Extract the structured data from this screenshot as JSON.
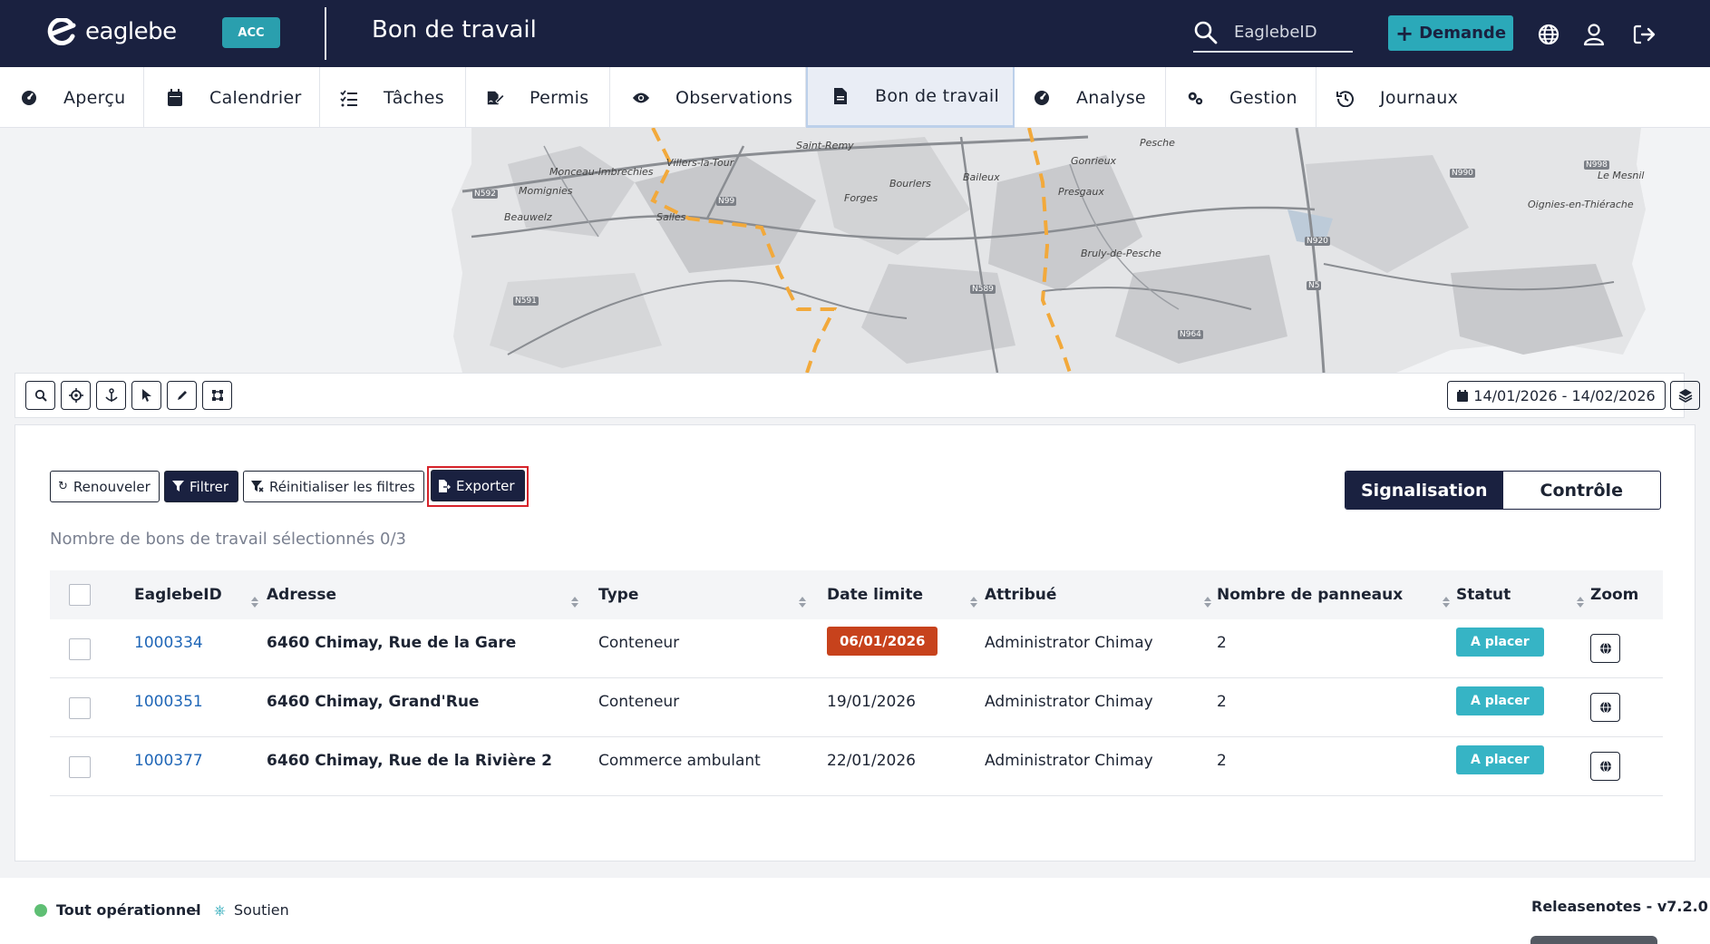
{
  "header": {
    "logo_text": "eaglebe",
    "env_badge": "ACC",
    "page_title": "Bon de travail",
    "search_placeholder": "EaglebeID",
    "demande_label": "Demande"
  },
  "nav": {
    "items": [
      {
        "label": "Aperçu",
        "icon": "gauge-icon"
      },
      {
        "label": "Calendrier",
        "icon": "calendar-icon"
      },
      {
        "label": "Tâches",
        "icon": "checklist-icon"
      },
      {
        "label": "Permis",
        "icon": "signature-icon"
      },
      {
        "label": "Observations",
        "icon": "eye-icon"
      },
      {
        "label": "Bon de travail",
        "icon": "file-icon",
        "active": true
      },
      {
        "label": "Analyse",
        "icon": "gauge-icon"
      },
      {
        "label": "Gestion",
        "icon": "gears-icon"
      },
      {
        "label": "Journaux",
        "icon": "history-icon"
      }
    ]
  },
  "map": {
    "places": [
      "Saint-Remy",
      "Pesche",
      "Villers-la-Tour",
      "Monceau-Imbrechies",
      "Gonrieux",
      "Momignies",
      "Bourlers",
      "Baileux",
      "Presgaux",
      "Forges",
      "Beauwelz",
      "Salles",
      "Bruly-de-Pesche",
      "Le Mesnil",
      "Oignies-en-Thiérache"
    ],
    "roads": [
      "N592",
      "N99",
      "N591",
      "N589",
      "N964",
      "N920",
      "N5",
      "N990",
      "N998"
    ]
  },
  "map_toolbar": {
    "date_range": "14/01/2026 - 14/02/2026"
  },
  "actions": {
    "renouveler": "Renouveler",
    "filtrer": "Filtrer",
    "reinitialiser": "Réinitialiser les filtres",
    "exporter": "Exporter"
  },
  "segment": {
    "left": "Signalisation",
    "right": "Contrôle"
  },
  "selection_count": "Nombre de bons de travail sélectionnés 0/3",
  "table": {
    "columns": [
      "EaglebeID",
      "Adresse",
      "Type",
      "Date limite",
      "Attribué",
      "Nombre de panneaux",
      "Statut",
      "Zoom"
    ],
    "rows": [
      {
        "id": "1000334",
        "adresse": "6460 Chimay, Rue de la Gare",
        "type": "Conteneur",
        "date": "06/01/2026",
        "overdue": true,
        "attribue": "Administrator Chimay",
        "panneaux": "2",
        "statut": "A placer"
      },
      {
        "id": "1000351",
        "adresse": "6460 Chimay, Grand'Rue",
        "type": "Conteneur",
        "date": "19/01/2026",
        "overdue": false,
        "attribue": "Administrator Chimay",
        "panneaux": "2",
        "statut": "A placer"
      },
      {
        "id": "1000377",
        "adresse": "6460 Chimay, Rue de la Rivière 2",
        "type": "Commerce ambulant",
        "date": "22/01/2026",
        "overdue": false,
        "attribue": "Administrator Chimay",
        "panneaux": "2",
        "statut": "A placer"
      }
    ]
  },
  "footer": {
    "status": "Tout opérationnel",
    "separator": "-",
    "support": "Soutien",
    "release": "Releasenotes - v7.2.0"
  },
  "colors": {
    "header_bg": "#1a2140",
    "accent": "#2ba9b9",
    "overdue": "#c7421c",
    "status": "#36b4c5"
  }
}
